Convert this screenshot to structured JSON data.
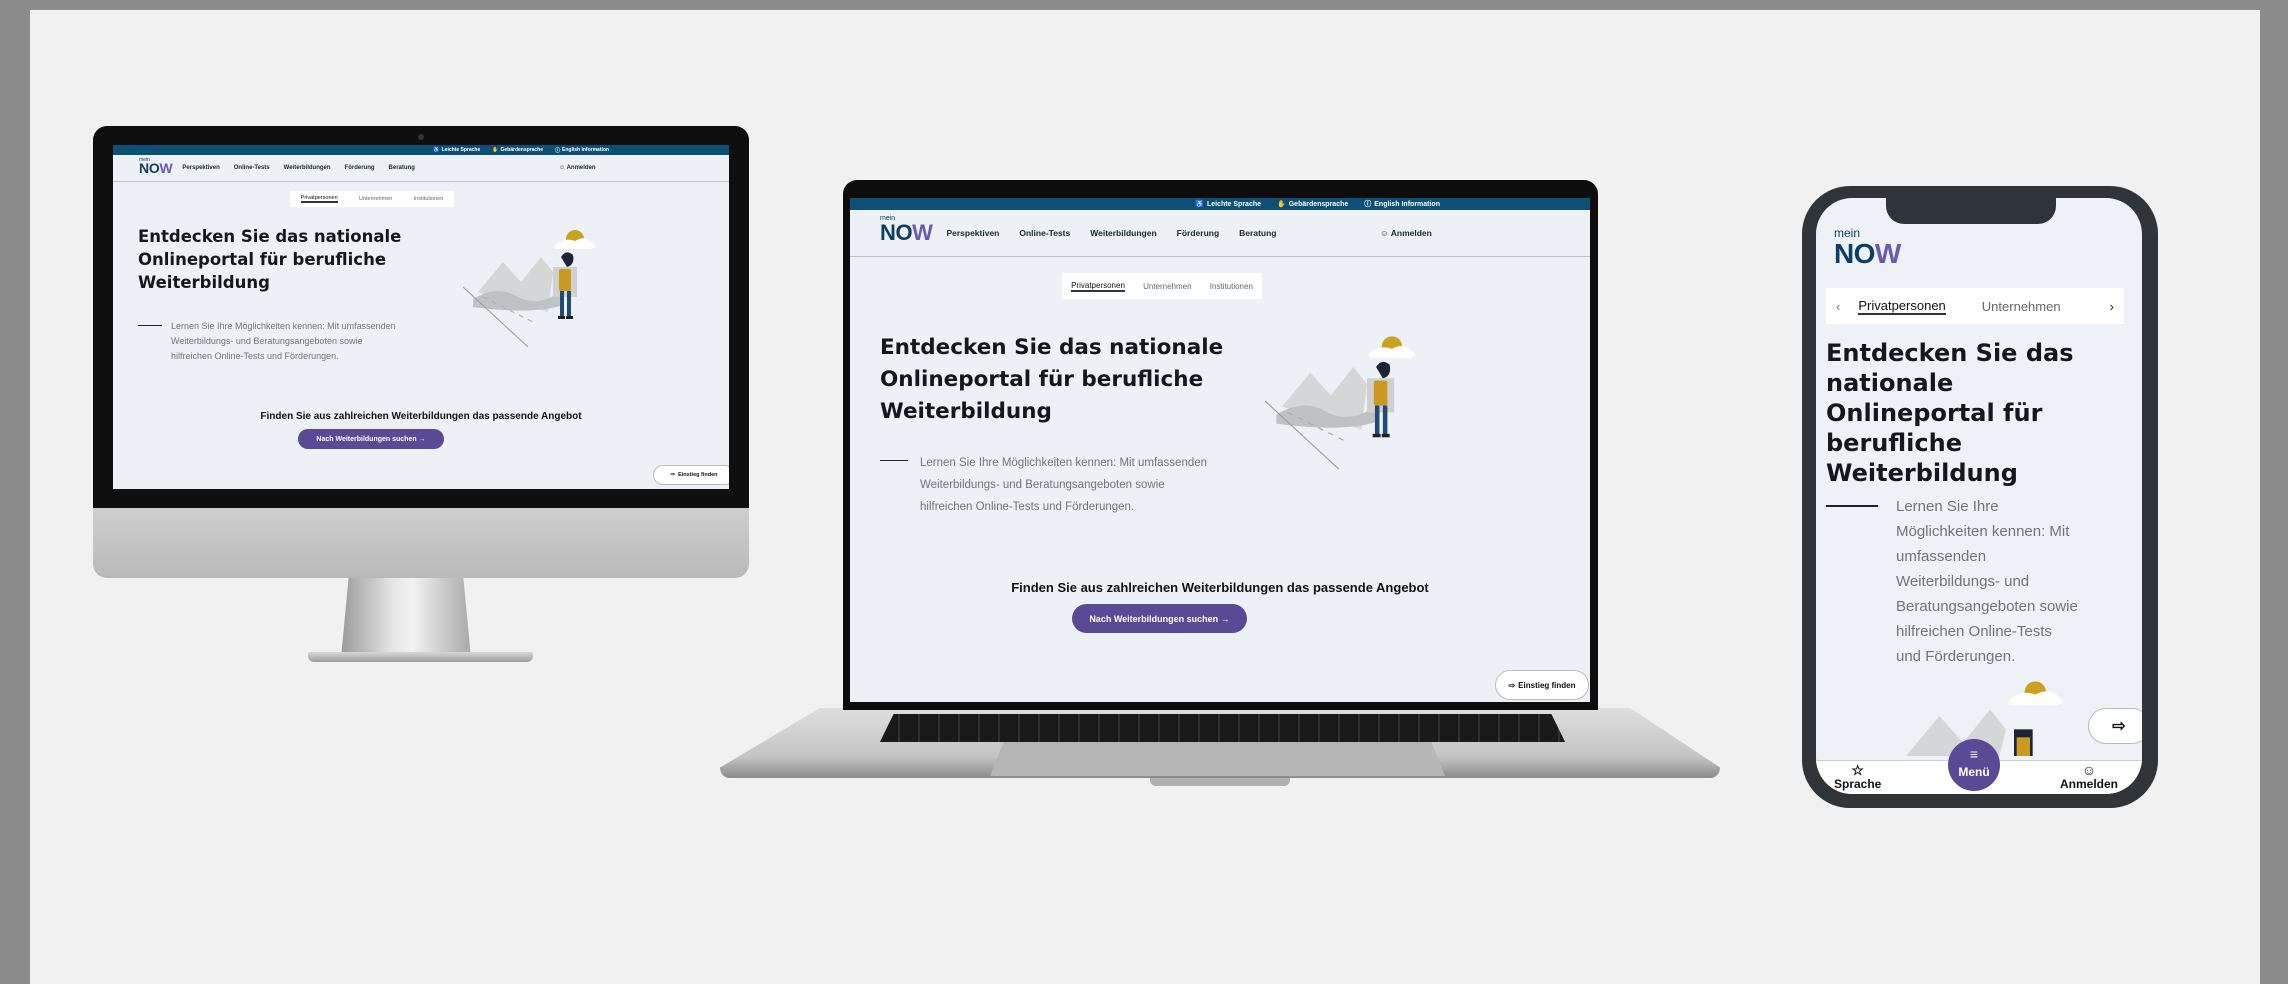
{
  "site": {
    "topbar": {
      "easy_language": "Leichte Sprache",
      "sign_language": "Gebärdensprache",
      "english": "English Information"
    },
    "logo": {
      "prefix": "mein",
      "word": "NO",
      "accent": "W"
    },
    "nav": [
      "Perspektiven",
      "Online-Tests",
      "Weiterbildungen",
      "Förderung",
      "Beratung"
    ],
    "login": "Anmelden",
    "tabs": [
      "Privatpersonen",
      "Unternehmen",
      "Institutionen"
    ],
    "headline_lines": [
      "Entdecken Sie das nationale",
      "Onlineportal für berufliche",
      "Weiterbildung"
    ],
    "lead_lines": [
      "Lernen Sie Ihre Möglichkeiten kennen: Mit umfassenden",
      "Weiterbildungs- und Beratungsangeboten sowie",
      "hilfreichen Online-Tests und Förderungen."
    ],
    "cta_text": "Finden Sie aus zahlreichen Weiterbildungen das passende Angebot",
    "cta_button": "Nach Weiterbildungen suchen →",
    "einstieg": "Einstieg finden"
  },
  "mobile": {
    "tabs": [
      "Privatpersonen",
      "Unternehmen"
    ],
    "headline_lines": [
      "Entdecken Sie das",
      "nationale",
      "Onlineportal für",
      "berufliche",
      "Weiterbildung"
    ],
    "lead_lines": [
      "Lernen Sie Ihre",
      "Möglichkeiten kennen: Mit",
      "umfassenden",
      "Weiterbildungs- und",
      "Beratungsangeboten sowie",
      "hilfreichen Online-Tests",
      "und Förderungen."
    ],
    "bottom_nav": {
      "language": "Sprache",
      "menu": "Menü",
      "login": "Anmelden"
    }
  },
  "colors": {
    "brand_blue": "#0d5077",
    "brand_purple": "#5a4a96",
    "page_bg": "#edf0f4",
    "stage_bg": "#f1f1f1"
  }
}
